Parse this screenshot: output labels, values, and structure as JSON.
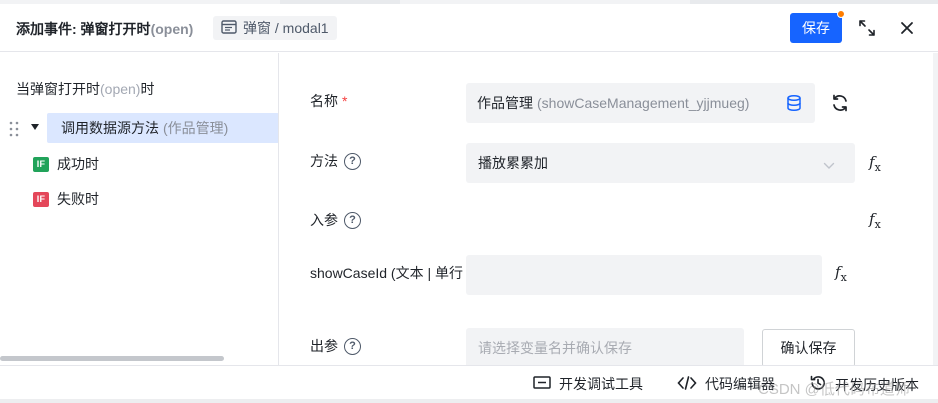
{
  "header": {
    "title_prefix": "添加事件: 弹窗打开时",
    "title_trigger": "(open)",
    "tag_label": "弹窗 / modal1",
    "save_label": "保存"
  },
  "tree": {
    "root_label": "当弹窗打开时",
    "root_trigger": "(open)",
    "root_suffix": "时",
    "node_label": "调用数据源方法",
    "node_sub": "(作品管理)",
    "success_badge": "IF",
    "success_label": "成功时",
    "fail_badge": "IF",
    "fail_label": "失败时"
  },
  "form": {
    "name_label": "名称",
    "name_required": "*",
    "name_value": "作品管理",
    "name_sub": "(showCaseManagement_yjjmueg)",
    "method_label": "方法",
    "method_value": "播放累累加",
    "input_params_label": "入参",
    "param_label": "showCaseId (文本 | 单行",
    "param_value": "",
    "output_params_label": "出参",
    "output_placeholder": "请选择变量名并确认保存",
    "confirm_label": "确认保存",
    "help_glyph": "?",
    "fx_glyph": "f",
    "fx_sub": "x"
  },
  "footer": {
    "devtools_label": "开发调试工具",
    "code_editor_label": "代码编辑器",
    "history_label": "开发历史版本",
    "watermark": "CSDN @低代码布道师"
  },
  "colors": {
    "primary": "#1664ff",
    "badge_dot": "#ff7d00",
    "success": "#21a35a",
    "danger": "#e4475a",
    "selected_bg": "#dbe7ff"
  }
}
